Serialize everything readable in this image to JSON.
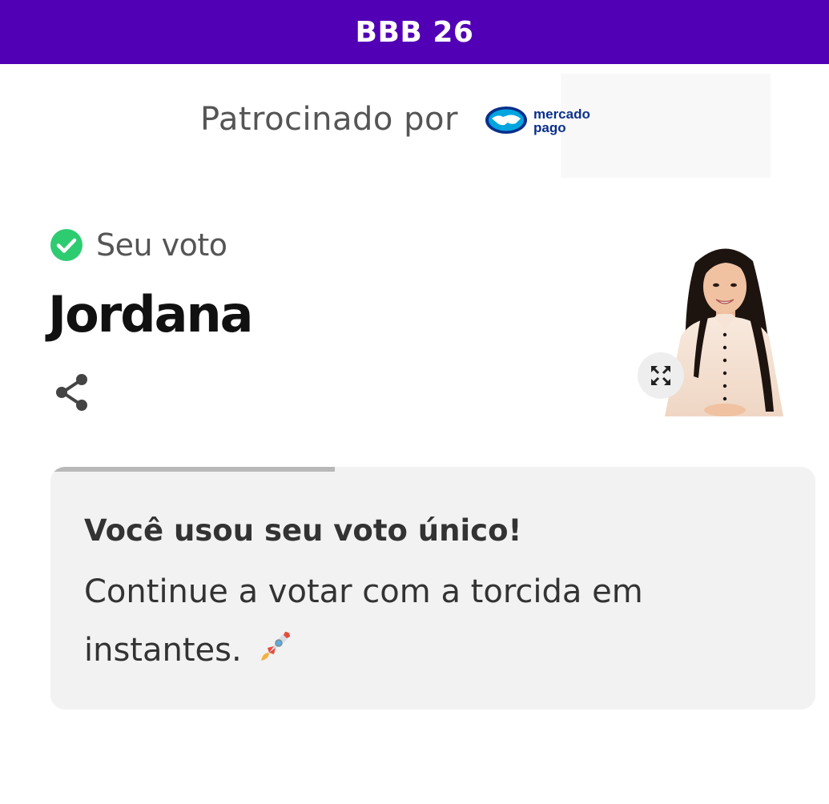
{
  "header": {
    "title": "BBB 26"
  },
  "sponsor": {
    "label": "Patrocinado por",
    "logo_text_line1": "mercado",
    "logo_text_line2": "pago",
    "logo_icon": "handshake-icon",
    "logo_color": "#0a2f8a",
    "logo_accent": "#00a5e0"
  },
  "vote": {
    "status_label": "Seu voto",
    "status_icon": "check-circle-icon",
    "status_color": "#2ecc71",
    "candidate_name": "Jordana",
    "share_icon": "share-icon",
    "expand_icon": "expand-icon"
  },
  "message": {
    "title": "Você usou seu voto único!",
    "body": "Continue a votar com a torcida em instantes.",
    "emoji_icon": "rocket-icon"
  },
  "colors": {
    "brand_purple": "#5200b5",
    "card_background": "#f2f2f2",
    "text_dark": "#333333",
    "text_muted": "#555555"
  }
}
